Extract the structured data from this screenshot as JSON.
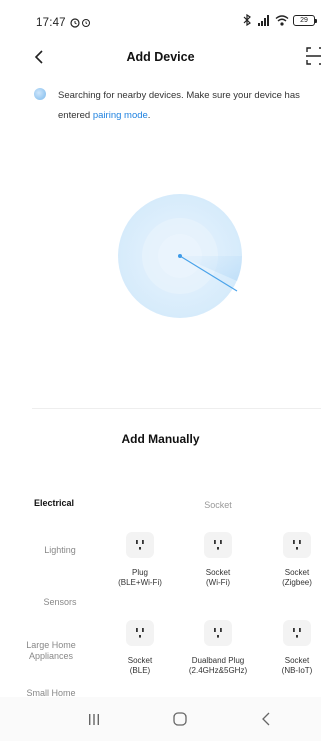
{
  "status_bar": {
    "time": "17:47",
    "battery": "29",
    "icons": [
      "alarm-icon",
      "alarm-icon",
      "bluetooth-icon",
      "signal-icon",
      "wifi-icon",
      "battery-icon"
    ]
  },
  "header": {
    "title": "Add Device",
    "back_icon": "chevron-left-icon",
    "scan_icon": "scan-icon"
  },
  "search": {
    "text": "Searching for nearby devices. Make sure your device has entered ",
    "link": "pairing mode",
    "suffix": "."
  },
  "manual": {
    "title": "Add Manually"
  },
  "categories": [
    {
      "label": "Electrical",
      "active": true
    },
    {
      "label": "Lighting",
      "active": false
    },
    {
      "label": "Sensors",
      "active": false
    },
    {
      "label": "Large Home Appliances",
      "active": false
    },
    {
      "label": "Small Home Appliances",
      "active": false
    }
  ],
  "section": {
    "title": "Socket"
  },
  "devices": [
    {
      "name_line1": "Plug",
      "name_line2": "(BLE+Wi-Fi)"
    },
    {
      "name_line1": "Socket",
      "name_line2": "(Wi-Fi)"
    },
    {
      "name_line1": "Socket",
      "name_line2": "(Zigbee)"
    },
    {
      "name_line1": "Socket",
      "name_line2": "(BLE)"
    },
    {
      "name_line1": "Dualband Plug",
      "name_line2": "(2.4GHz&5GHz)"
    },
    {
      "name_line1": "Socket",
      "name_line2": "(NB-IoT)"
    }
  ],
  "colors": {
    "accent": "#1f82e0",
    "radar": "#bfe0f8"
  }
}
